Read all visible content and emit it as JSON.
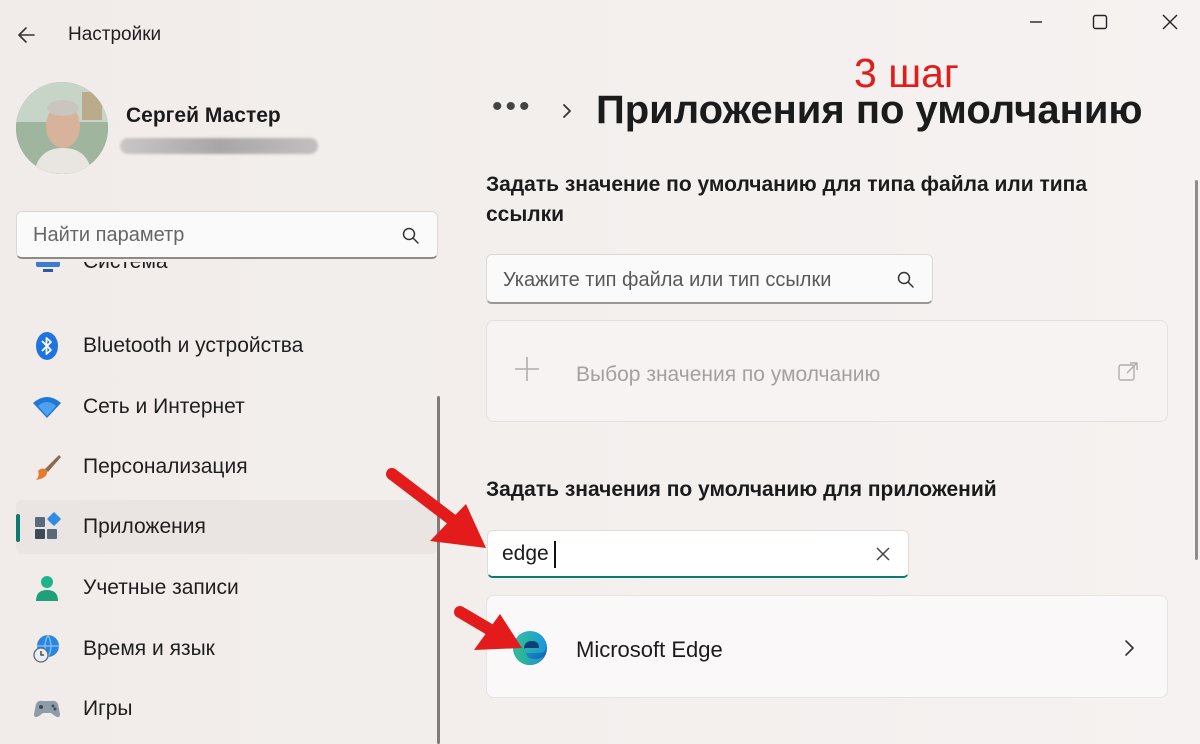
{
  "window": {
    "title": "Настройки",
    "controls": [
      "minimize-icon",
      "maximize-icon",
      "close-icon"
    ]
  },
  "profile": {
    "name": "Сергей Мастер"
  },
  "sidebar": {
    "search_placeholder": "Найти параметр",
    "partial_item": "Система",
    "items": [
      {
        "label": "Bluetooth и устройства",
        "icon": "bluetooth-icon"
      },
      {
        "label": "Сеть и Интернет",
        "icon": "wifi-icon"
      },
      {
        "label": "Персонализация",
        "icon": "brush-icon"
      },
      {
        "label": "Приложения",
        "icon": "apps-icon",
        "active": true
      },
      {
        "label": "Учетные записи",
        "icon": "account-icon"
      },
      {
        "label": "Время и язык",
        "icon": "time-language-icon"
      },
      {
        "label": "Игры",
        "icon": "gamepad-icon"
      }
    ]
  },
  "main": {
    "breadcrumb_dots": "•••",
    "page_title": "Приложения по умолчанию",
    "annotation": "3 шаг",
    "section_file_type": "Задать значение по умолчанию для типа файла или типа ссылки",
    "file_type_placeholder": "Укажите тип файла или тип ссылки",
    "choose_default_label": "Выбор значения по умолчанию",
    "section_apps": "Задать значения по умолчанию для приложений",
    "app_search_value": "edge",
    "result_app": "Microsoft Edge"
  },
  "colors": {
    "accent": "#0c7a6e",
    "annotation": "#e31b1b",
    "arrow": "#e31b1b"
  }
}
